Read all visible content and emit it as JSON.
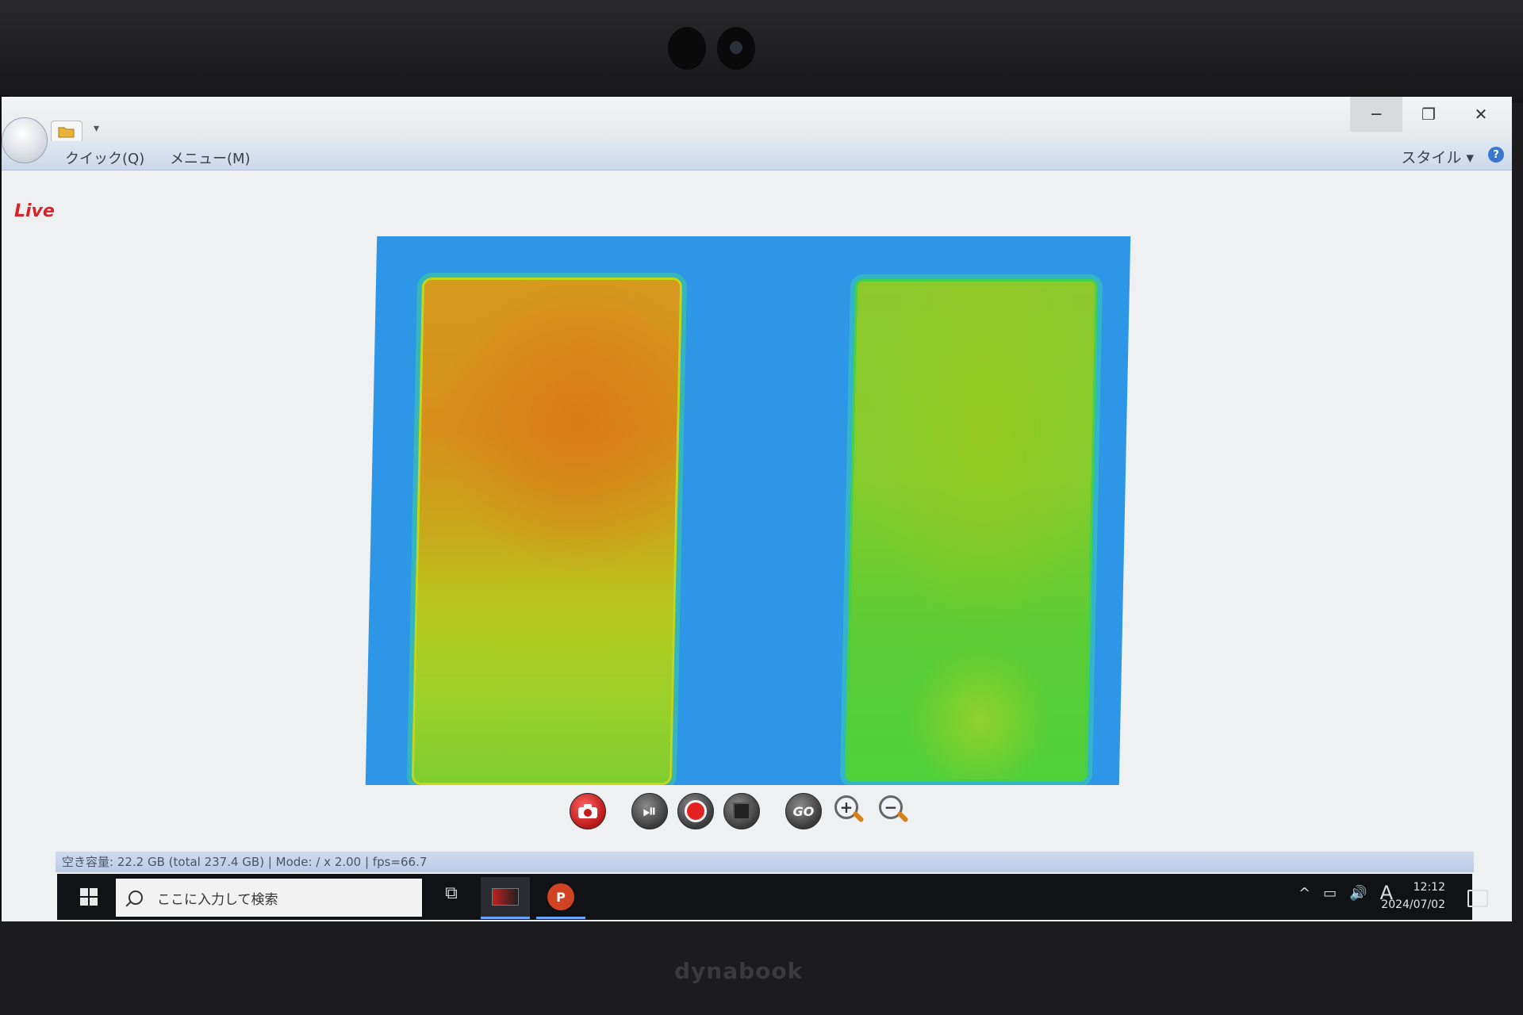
{
  "device": {
    "brand": "dynabook"
  },
  "titlebar": {
    "qat_dropdown": "▾",
    "minimize_glyph": "─",
    "restore_glyph": "❐",
    "close_glyph": "✕"
  },
  "ribbon": {
    "tabs": [
      {
        "label": "クイック(Q)"
      },
      {
        "label": "メニュー(M)"
      }
    ],
    "style_menu": "スタイル ▾",
    "help": "?"
  },
  "view": {
    "live_label": "Live"
  },
  "toolbar": {
    "buttons": [
      "camera-icon",
      "play-pause-icon",
      "record-icon",
      "stop-icon",
      "go-icon",
      "zoom-in-icon",
      "zoom-out-icon"
    ],
    "play_pause_glyph": "⏯",
    "go_label": "GO",
    "zoom_in_glyph": "+",
    "zoom_out_glyph": "−"
  },
  "statusbar": {
    "text": "空き容量: 22.2 GB (total 237.4 GB) | Mode:  / x 2.00 | fps=66.7"
  },
  "taskbar": {
    "search_placeholder": "ここに入力して検索",
    "task_view_glyph": "⧉",
    "ppt_letter": "P",
    "tray": {
      "chevron": "^",
      "battery": "▭",
      "volume": "🔊",
      "ime": "A"
    },
    "time": "12:12",
    "date": "2024/07/02"
  },
  "colors": {
    "live": "#d8232a",
    "thermal_background": "#2d96e6",
    "hot": "#d68f1a",
    "warm": "#b7c820",
    "cool": "#4fd03a"
  }
}
